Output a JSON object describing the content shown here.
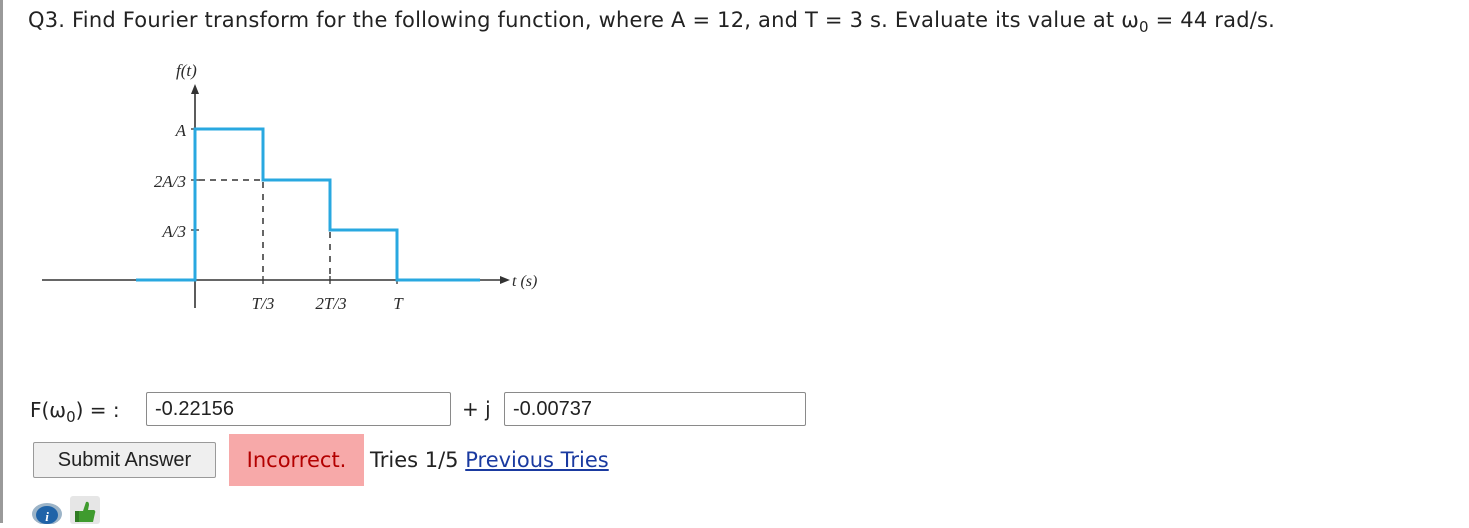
{
  "question": {
    "prefix": "Q3. Find Fourier transform for the following function, where A = 12, and T = 3 s. Evaluate its value at ω",
    "omega_sub": "0",
    "suffix": " = 44 rad/s."
  },
  "figure": {
    "y_axis_label": "f(t)",
    "x_axis_label": "t (s)",
    "y_ticks": [
      "A",
      "2A/3",
      "A/3"
    ],
    "x_ticks": [
      "T/3",
      "2T/3",
      "T"
    ],
    "line_color": "#29a8e0"
  },
  "answer": {
    "label_prefix": "F(ω",
    "label_sub": "0",
    "label_suffix": ") = :",
    "real_value": "-0.22156",
    "plus_j": "+ j",
    "imag_value": "-0.00737"
  },
  "submit_label": "Submit Answer",
  "feedback": {
    "status": "Incorrect.",
    "tries": "Tries 1/5",
    "previous_tries_link": "Previous Tries"
  },
  "icons": [
    "info-icon",
    "thumbs-up-icon"
  ]
}
